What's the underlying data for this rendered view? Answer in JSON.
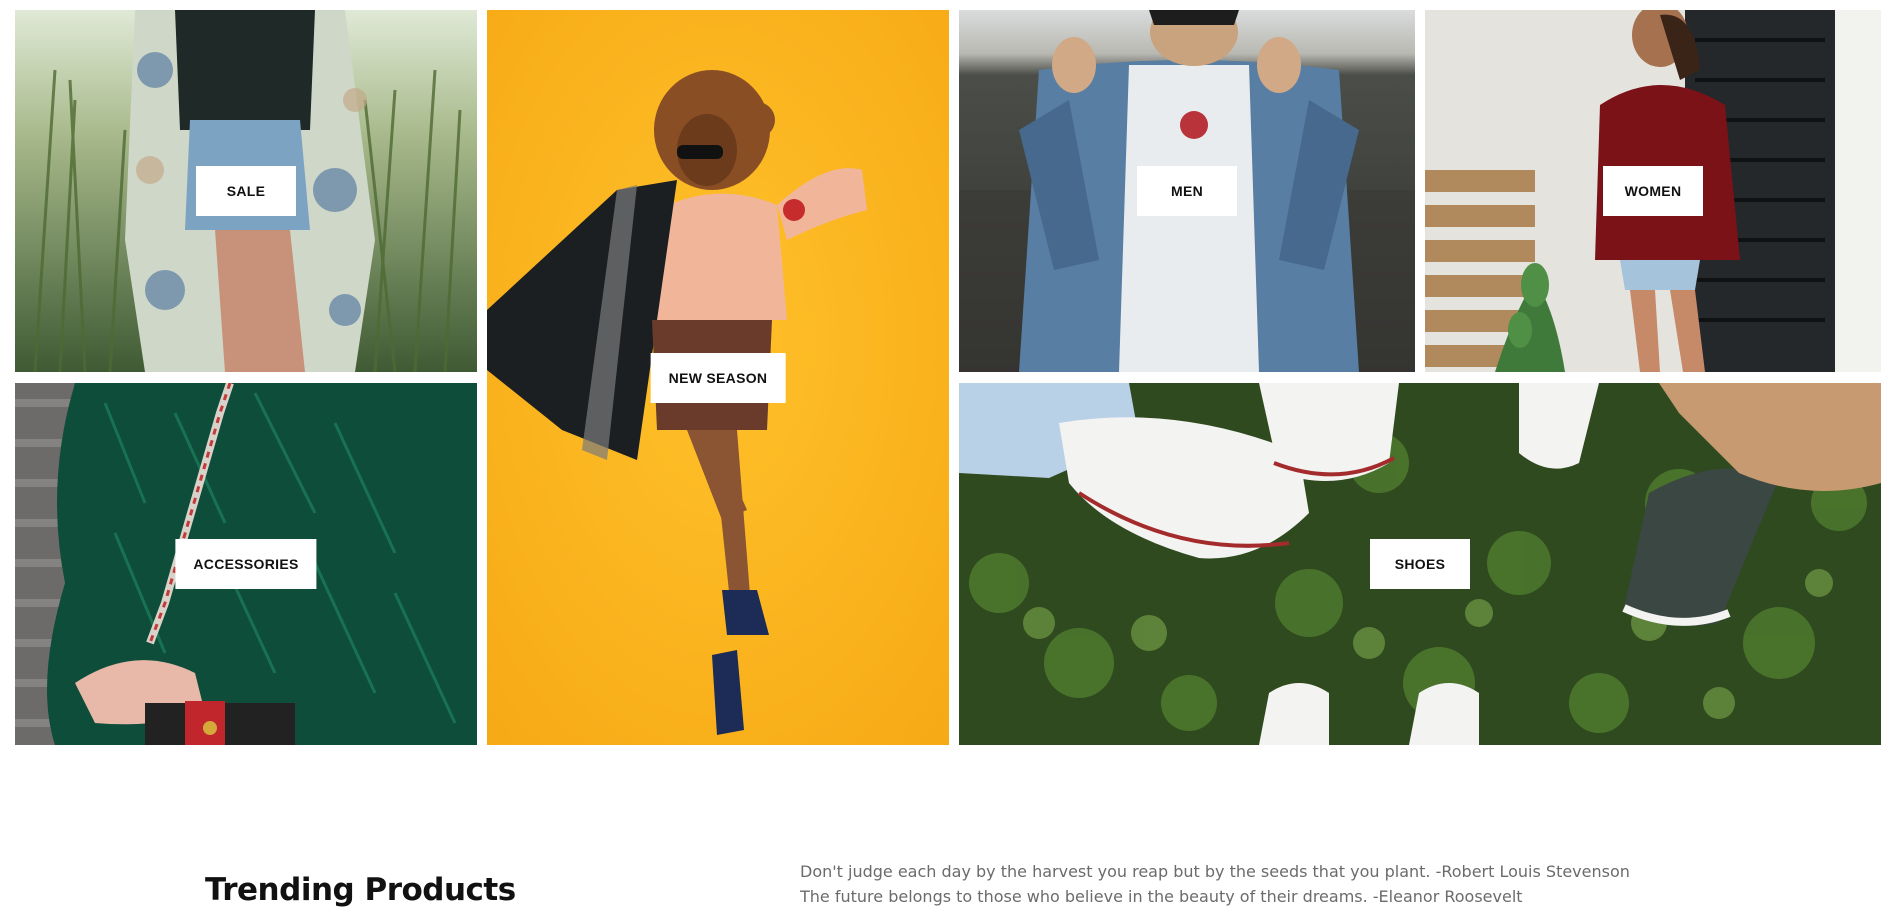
{
  "categories": {
    "sale": "SALE",
    "new_season": "NEW SEASON",
    "men": "MEN",
    "women": "WOMEN",
    "accessories": "ACCESSORIES",
    "shoes": "SHOES"
  },
  "trending": {
    "title": "Trending Products",
    "quotes": [
      "Don't judge each day by the harvest you reap but by the seeds that you plant. -Robert Louis Stevenson",
      "The future belongs to those who believe in the beauty of their dreams. -Eleanor Roosevelt"
    ]
  }
}
